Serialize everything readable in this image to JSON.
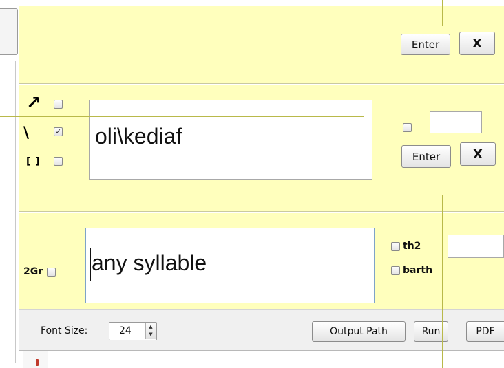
{
  "panel_top": {
    "enter_label": "Enter",
    "close_label": "X"
  },
  "panel_middle": {
    "symbols": [
      "↗",
      "\\",
      "[ ]"
    ],
    "checkboxes": [
      false,
      true,
      false
    ],
    "upper_text": "",
    "main_text": "oli\\kediaf",
    "side_checkbox": false,
    "side_input": "",
    "enter_label": "Enter",
    "close_label": "X"
  },
  "panel_bottom": {
    "label": "2Gr",
    "checkbox": false,
    "input_value": "any syllable",
    "options": [
      {
        "label": "th2",
        "checked": false
      },
      {
        "label": "barth",
        "checked": false
      }
    ],
    "side_input": ""
  },
  "toolbar": {
    "font_size_label": "Font Size:",
    "font_size_value": "24",
    "output_path_label": "Output Path",
    "run_label": "Run",
    "pdf_label": "PDF"
  },
  "colors": {
    "panel_bg": "#ffffbd",
    "toolbar_bg": "#f0f0f0",
    "guide_line": "#b9b94a"
  }
}
